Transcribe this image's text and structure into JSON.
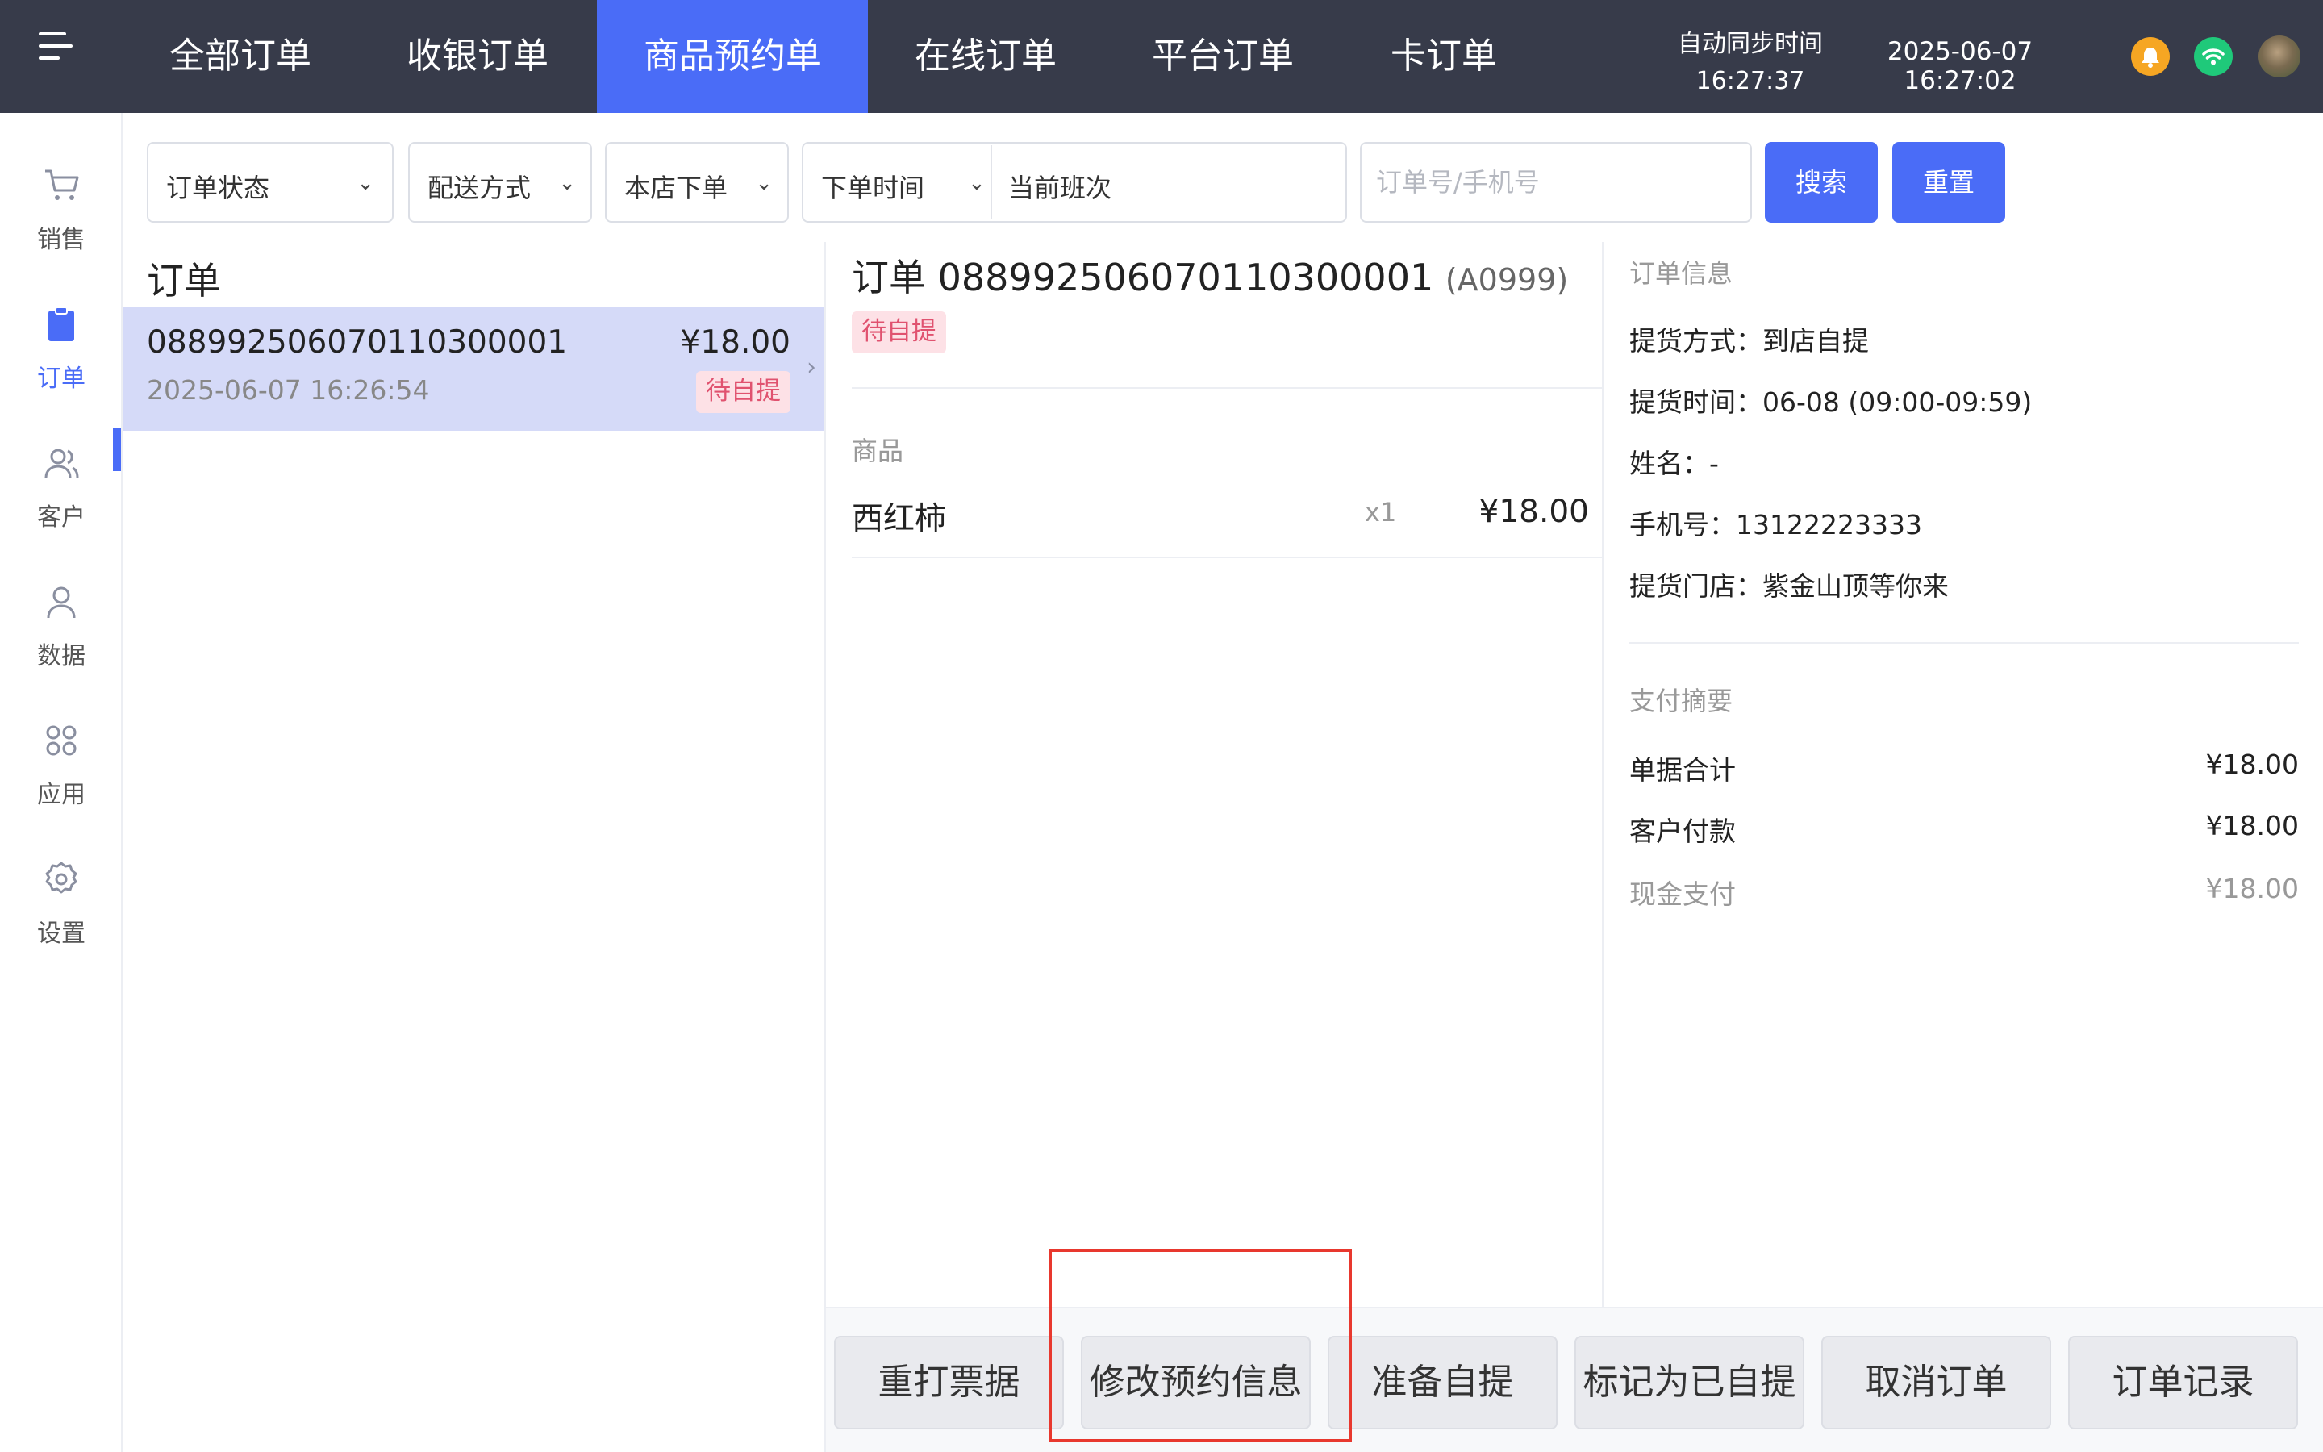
{
  "header": {
    "tabs": [
      {
        "label": "全部订单"
      },
      {
        "label": "收银订单"
      },
      {
        "label": "商品预约单"
      },
      {
        "label": "在线订单"
      },
      {
        "label": "平台订单"
      },
      {
        "label": "卡订单"
      }
    ],
    "active_tab": "商品预约单",
    "sync_label": "自动同步时间",
    "sync_time": "16:27:37",
    "current_datetime": "2025-06-07 16:27:02",
    "icons": [
      "menu-icon",
      "bell-icon",
      "wifi-icon",
      "avatar"
    ]
  },
  "sidebar": {
    "items": [
      {
        "label": "销售",
        "icon": "cart-icon"
      },
      {
        "label": "订单",
        "icon": "clipboard-icon"
      },
      {
        "label": "客户",
        "icon": "users-icon"
      },
      {
        "label": "数据",
        "icon": "user-icon"
      },
      {
        "label": "应用",
        "icon": "apps-icon"
      },
      {
        "label": "设置",
        "icon": "gear-icon"
      }
    ],
    "active": "订单"
  },
  "filters": {
    "order_status": "订单状态",
    "delivery": "配送方式",
    "store": "本店下单",
    "time_type": "下单时间",
    "time_value": "当前班次",
    "search_placeholder": "订单号/手机号",
    "search_btn": "搜索",
    "reset_btn": "重置"
  },
  "order_list": {
    "title": "订单",
    "orders": [
      {
        "no": "08899250607011030000 1",
        "price": "¥18.00",
        "time": "2025-06-07 16:26:54",
        "status": "待自提"
      }
    ]
  },
  "detail": {
    "title_prefix": "订单",
    "order_no": "088992506070110300001",
    "code": "(A0999)",
    "status": "待自提",
    "products_label": "商品",
    "products": [
      {
        "name": "西红柿",
        "qty": "x1",
        "price": "¥18.00"
      }
    ]
  },
  "info": {
    "title": "订单信息",
    "pickup_method": "提货方式：到店自提",
    "pickup_time": "提货时间：06-08 (09:00-09:59)",
    "name": "姓名：-",
    "phone": "手机号：13122223333",
    "store": "提货门店：紫金山顶等你来",
    "pay_title": "支付摘要",
    "pay_rows": [
      {
        "label": "单据合计",
        "value": "¥18.00"
      },
      {
        "label": "客户付款",
        "value": "¥18.00"
      },
      {
        "label": "现金支付",
        "value": "¥18.00"
      }
    ]
  },
  "actions": [
    "重打票据",
    "修改预约信息",
    "准备自提",
    "标记为已自提",
    "取消订单",
    "订单记录"
  ],
  "colors": {
    "topbar": "#373b4a",
    "accent": "#4a6cf7",
    "badge_bg": "#fde1e6",
    "badge_text": "#e0526f",
    "highlight": "#e8382e"
  }
}
